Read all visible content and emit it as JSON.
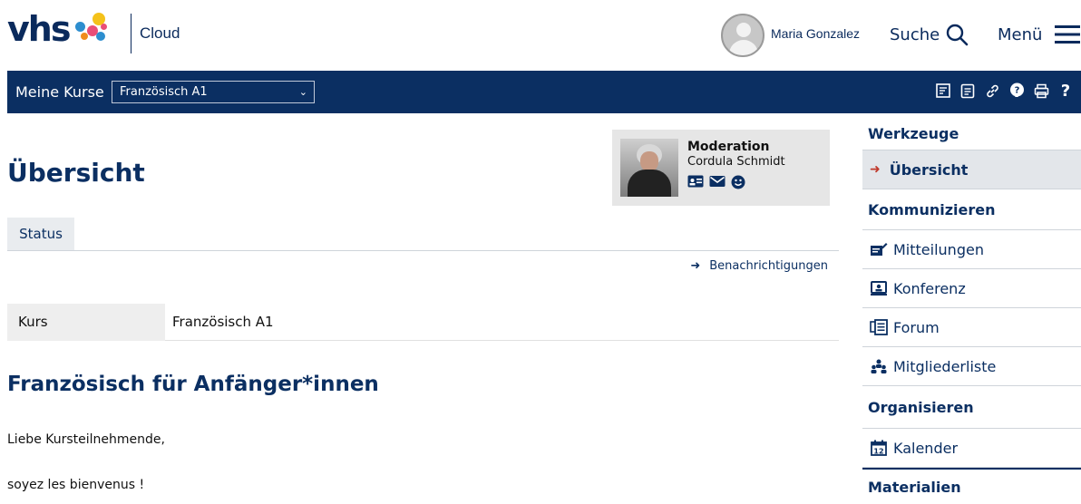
{
  "header": {
    "logo_text": "vhs",
    "logo_sub": "Cloud",
    "user_name": "Maria Gonzalez",
    "search_label": "Suche",
    "menu_label": "Menü"
  },
  "nav": {
    "label": "Meine Kurse",
    "course_selected": "Französisch A1",
    "icons": [
      "feed-icon",
      "notes-icon",
      "link-icon",
      "help-bubble-icon",
      "print-icon",
      "question-icon"
    ]
  },
  "main": {
    "title": "Übersicht",
    "moderator": {
      "title": "Moderation",
      "name": "Cordula Schmidt"
    },
    "tab": "Status",
    "notifications_link": "Benachrichtigungen",
    "kurs_label": "Kurs",
    "kurs_value": "Französisch A1",
    "section_title": "Französisch für Anfänger*innen",
    "paragraphs": [
      "Liebe Kursteilnehmende,",
      "soyez les bienvenus !"
    ]
  },
  "sidebar": {
    "sections": [
      {
        "title": "Werkzeuge",
        "items": [
          {
            "label": "Übersicht",
            "active": true
          }
        ]
      },
      {
        "title": "Kommunizieren",
        "items": [
          {
            "label": "Mitteilungen"
          },
          {
            "label": "Konferenz"
          },
          {
            "label": "Forum"
          },
          {
            "label": "Mitgliederliste"
          }
        ]
      },
      {
        "title": "Organisieren",
        "items": [
          {
            "label": "Kalender"
          }
        ]
      },
      {
        "title": "Materialien",
        "items": []
      }
    ]
  },
  "colors": {
    "primary": "#0b2f62",
    "accent_red": "#c0392b"
  }
}
